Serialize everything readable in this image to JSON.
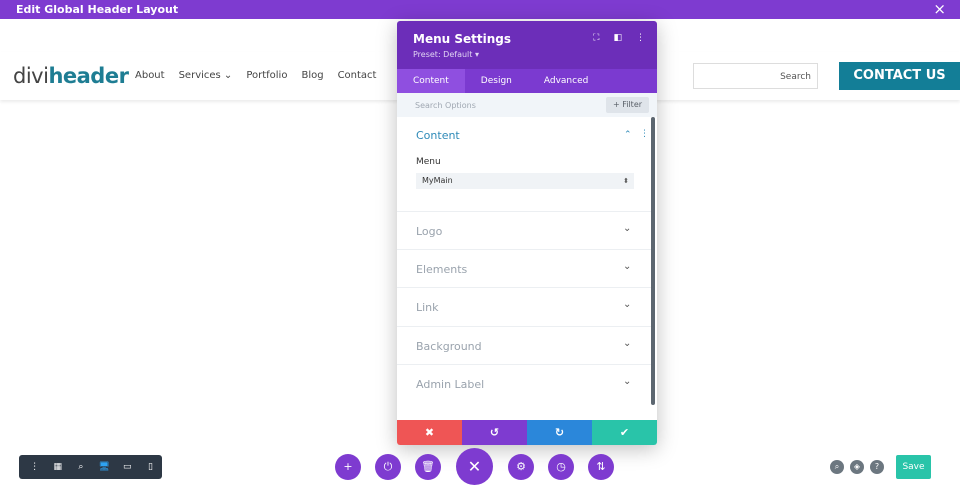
{
  "topbar": {
    "title": "Edit Global Header Layout",
    "close_icon": "×"
  },
  "header": {
    "logo": {
      "part1": "divi",
      "part2": "header"
    },
    "nav": [
      "About",
      "Services ⌄",
      "Portfolio",
      "Blog",
      "Contact"
    ],
    "search": {
      "placeholder": "Search"
    },
    "contact_button": "CONTACT US"
  },
  "modal": {
    "title": "Menu Settings",
    "preset": "Preset: Default ▾",
    "header_icons": {
      "expand": "⛶",
      "sidebar": "◧",
      "more": "⋮"
    },
    "tabs": [
      "Content",
      "Design",
      "Advanced"
    ],
    "search_placeholder": "Search Options",
    "filter_label": "+ Filter",
    "content_section": {
      "title": "Content",
      "caret": "⌃",
      "dots": "⋮",
      "menu_label": "Menu",
      "menu_value": "MyMain",
      "menu_arrow": "⬍"
    },
    "accordions": [
      "Logo",
      "Elements",
      "Link",
      "Background",
      "Admin Label"
    ],
    "chevron": "⌄",
    "actions": {
      "cancel": "✖",
      "undo": "↺",
      "redo": "↻",
      "confirm": "✔"
    }
  },
  "colors": {
    "accent_purple": "#7e3bd0",
    "cancel": "#ef5555",
    "undo": "#7e3bd0",
    "redo": "#2b87da",
    "confirm": "#29c4a9"
  },
  "bottom": {
    "left_tools": [
      "⋮",
      "▦",
      "⌕",
      "🖥",
      "▭",
      "▯"
    ],
    "center_buttons": [
      "+",
      "⏻",
      "🗑",
      "✕",
      "⚙",
      "◷",
      "⇅"
    ],
    "right_icons": [
      "⌕",
      "◈",
      "?"
    ],
    "save_label": "Save"
  }
}
